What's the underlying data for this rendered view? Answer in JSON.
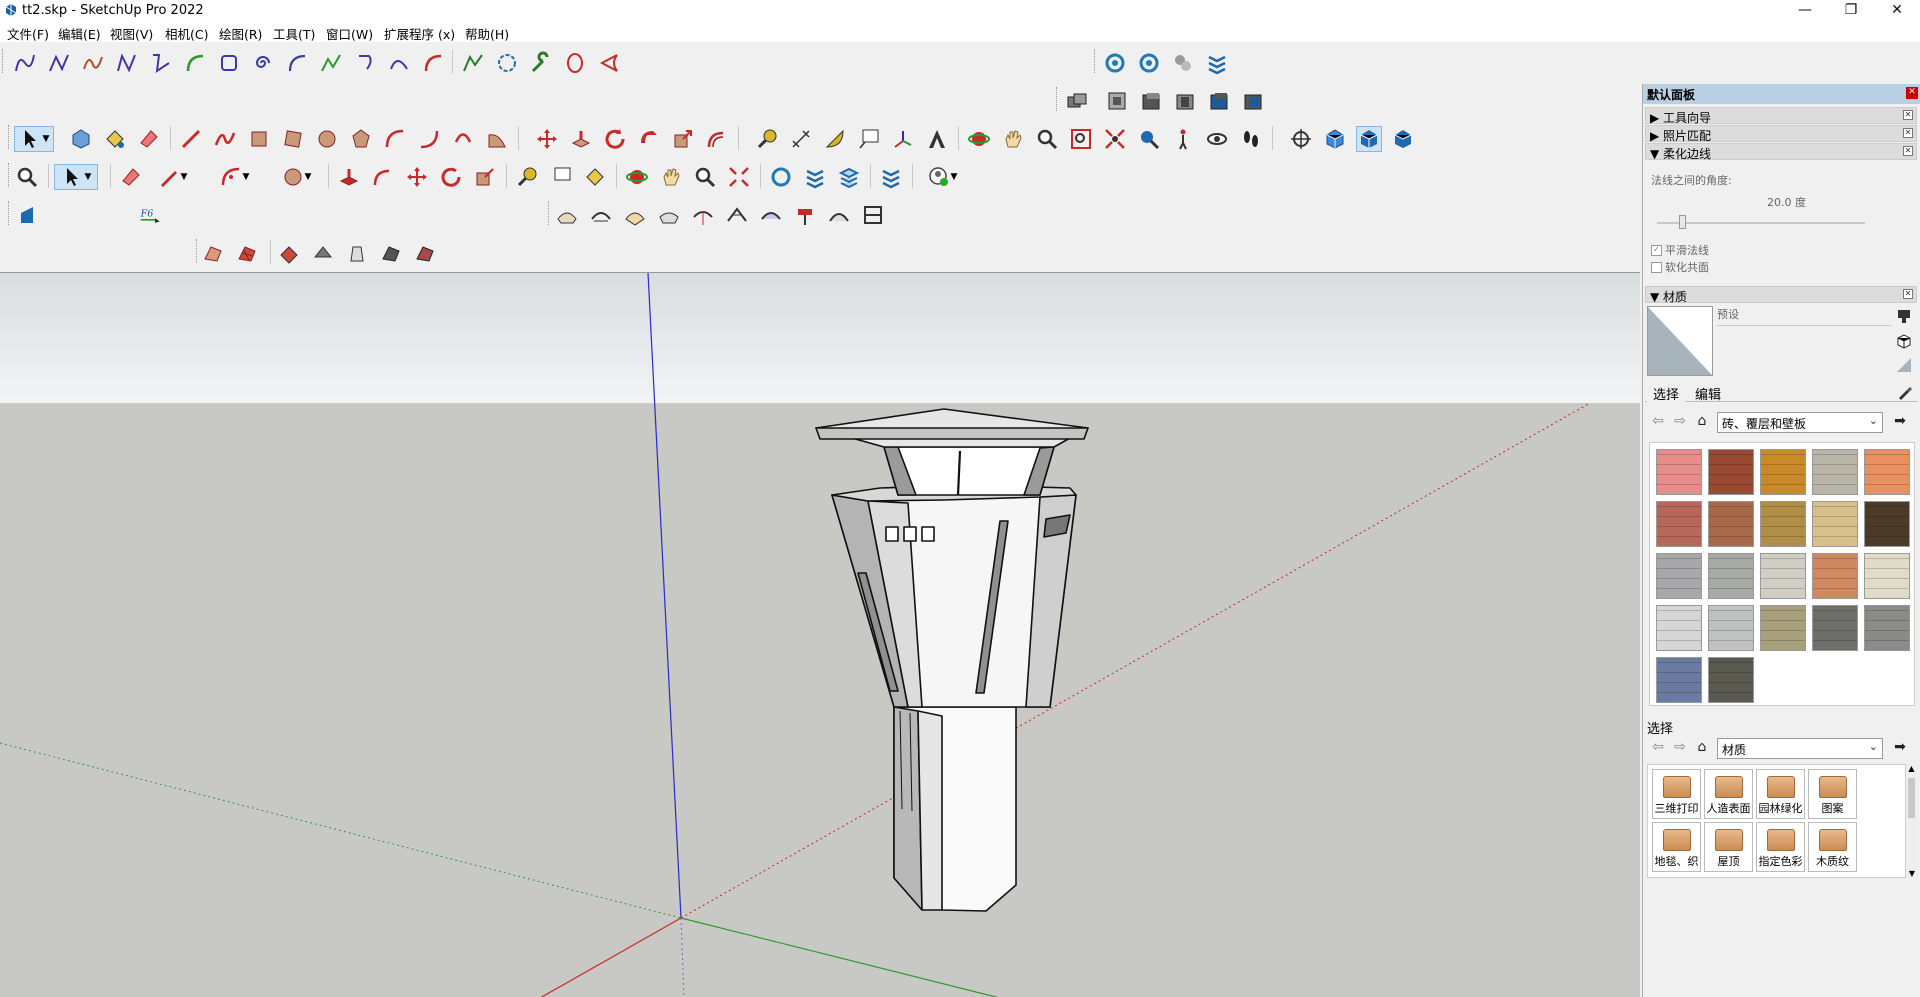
{
  "window": {
    "title": "tt2.skp - SketchUp Pro 2022",
    "minimize": "—",
    "maximize": "❐",
    "close": "✕"
  },
  "menu": [
    "文件(F)",
    "编辑(E)",
    "视图(V)",
    "相机(C)",
    "绘图(R)",
    "工具(T)",
    "窗口(W)",
    "扩展程序 (x)",
    "帮助(H)"
  ],
  "tray": {
    "title": "默认面板",
    "sections": {
      "instructor": "工具向导",
      "match_photo": "照片匹配",
      "soften_edges": "柔化边线",
      "materials": "材质"
    },
    "soften": {
      "angle_label": "法线之间的角度:",
      "angle_value": "20.0  度",
      "smooth_normals": "平滑法线",
      "soften_coplanar": "软化共面",
      "smooth_checked": true,
      "coplanar_checked": false
    },
    "materials": {
      "preset_label": "预设",
      "tab_select": "选择",
      "tab_edit": "编辑",
      "collection": "砖、覆层和壁板",
      "swatch_colors": [
        "#e98c8c",
        "#9a4a32",
        "#c98a2a",
        "#b8b4a8",
        "#e89060",
        "#b8685a",
        "#a8684a",
        "#b08e4a",
        "#d8c08a",
        "#4a3a28",
        "#a8a8aa",
        "#a8aaa6",
        "#d0cec4",
        "#d08860",
        "#e0dac8",
        "#d6d6d6",
        "#c0c2c2",
        "#a8a07a",
        "#6e6e6a",
        "#8a8a88",
        "#6a7aa0",
        "#5a5a50"
      ],
      "secondary_select": "选择",
      "secondary_dropdown": "材质",
      "folders": [
        "三维打印",
        "人造表面",
        "园林绿化",
        "图案",
        "地毯、织",
        "屋顶",
        "指定色彩",
        "木质纹"
      ]
    }
  }
}
